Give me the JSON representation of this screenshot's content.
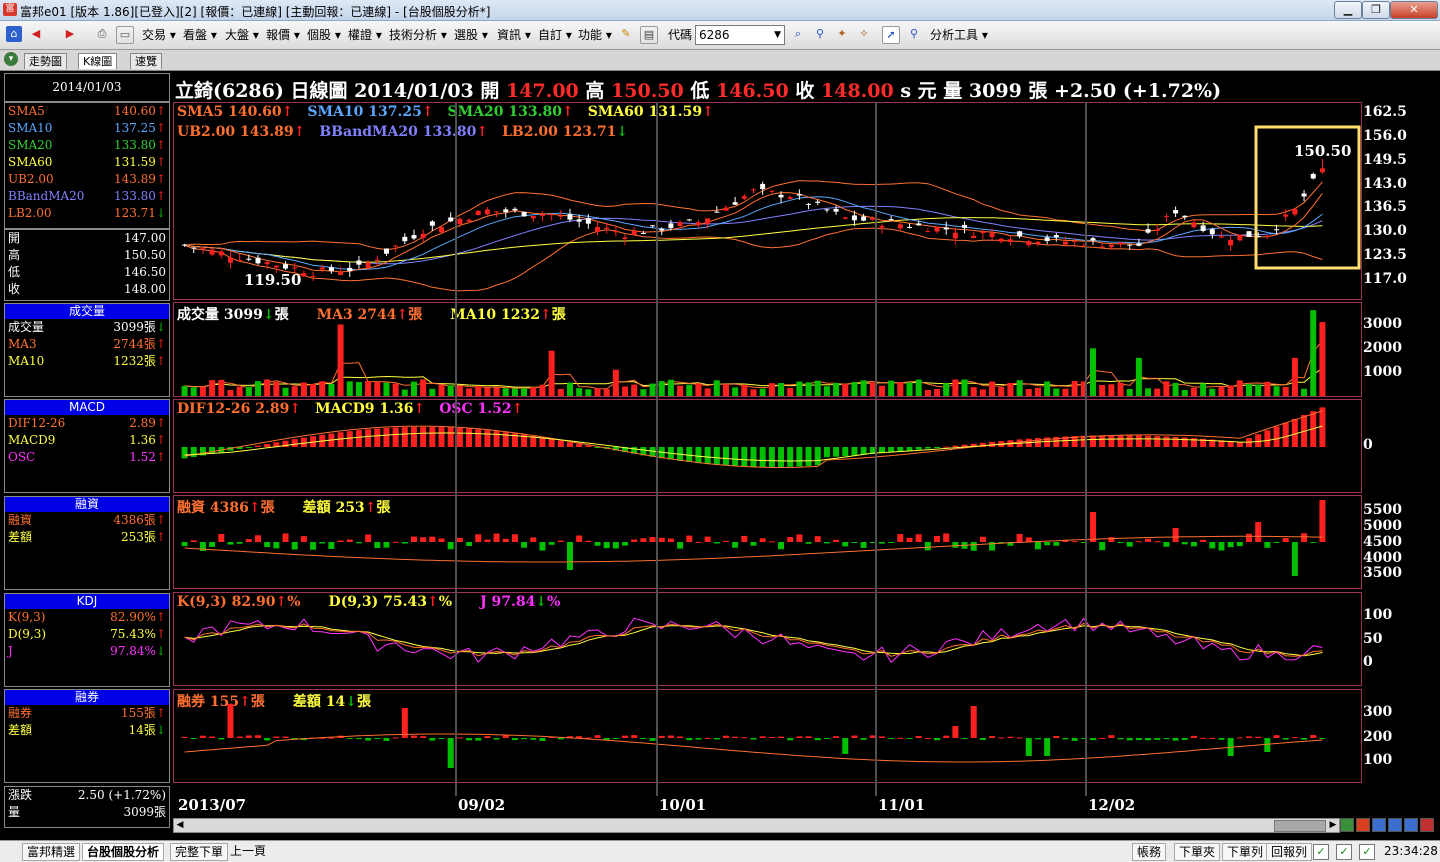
{
  "window": {
    "title": "富邦e01 [版本 1.86][已登入][2] [報價：已連線] [主動回報：已連線] - [台股個股分析*]",
    "controls": [
      "minimize",
      "restore",
      "close"
    ]
  },
  "toolbar": {
    "menus": [
      "交易",
      "看盤",
      "大盤",
      "報價",
      "個股",
      "權證",
      "技術分析",
      "選股",
      "資訊",
      "自訂",
      "功能"
    ],
    "code_label": "代碼",
    "code_value": "6286",
    "analysis_tools": "分析工具"
  },
  "subtabs": [
    "走勢圖",
    "K線圖",
    "速覽"
  ],
  "left": {
    "date": "2014/01/03",
    "ma_rows": [
      {
        "k": "SMA5",
        "v": "140.60",
        "color": "#ff7030",
        "arrow": "up"
      },
      {
        "k": "SMA10",
        "v": "137.25",
        "color": "#5aa7ff",
        "arrow": "up"
      },
      {
        "k": "SMA20",
        "v": "133.80",
        "color": "#30d030",
        "arrow": "up"
      },
      {
        "k": "SMA60",
        "v": "131.59",
        "color": "#ffff40",
        "arrow": "up"
      },
      {
        "k": "UB2.00",
        "v": "143.89",
        "color": "#ff7030",
        "arrow": "up"
      },
      {
        "k": "BBandMA20",
        "v": "133.80",
        "color": "#8080ff",
        "arrow": "up"
      },
      {
        "k": "LB2.00",
        "v": "123.71",
        "color": "#ff7030",
        "arrow": "down"
      }
    ],
    "ohlc_rows": [
      {
        "k": "開",
        "v": "147.00"
      },
      {
        "k": "高",
        "v": "150.50"
      },
      {
        "k": "低",
        "v": "146.50"
      },
      {
        "k": "收",
        "v": "148.00"
      }
    ],
    "vol": {
      "head": "成交量",
      "rows": [
        {
          "k": "成交量",
          "v": "3099張",
          "color": "#ffffff",
          "arrow": "down"
        },
        {
          "k": "MA3",
          "v": "2744張",
          "color": "#ff7030",
          "arrow": "up"
        },
        {
          "k": "MA10",
          "v": "1232張",
          "color": "#ffff40",
          "arrow": "up"
        }
      ]
    },
    "macd": {
      "head": "MACD",
      "rows": [
        {
          "k": "DIF12-26",
          "v": "2.89",
          "color": "#ff7030",
          "arrow": "up"
        },
        {
          "k": "MACD9",
          "v": "1.36",
          "color": "#ffff40",
          "arrow": "up"
        },
        {
          "k": "OSC",
          "v": "1.52",
          "color": "#ff30ff",
          "arrow": "up"
        }
      ]
    },
    "margin": {
      "head": "融資",
      "rows": [
        {
          "k": "融資",
          "v": "4386張",
          "color": "#ff7030",
          "arrow": "up"
        },
        {
          "k": "差額",
          "v": "253張",
          "color": "#ffff40",
          "arrow": "up"
        }
      ]
    },
    "kdj": {
      "head": "KDJ",
      "rows": [
        {
          "k": "K(9,3)",
          "v": "82.90%",
          "color": "#ff7030",
          "arrow": "up"
        },
        {
          "k": "D(9,3)",
          "v": "75.43%",
          "color": "#ffff40",
          "arrow": "up"
        },
        {
          "k": "J",
          "v": "97.84%",
          "color": "#ff30ff",
          "arrow": "down"
        }
      ]
    },
    "short": {
      "head": "融券",
      "rows": [
        {
          "k": "融券",
          "v": "155張",
          "color": "#ff7030",
          "arrow": "up"
        },
        {
          "k": "差額",
          "v": "14張",
          "color": "#ffff40",
          "arrow": "down"
        }
      ]
    },
    "bottom_rows": [
      {
        "k": "漲跌",
        "v": "2.50 (+1.72%)"
      },
      {
        "k": "量",
        "v": "3099張"
      }
    ]
  },
  "header": {
    "stock": "立錡(6286)",
    "period": "日線圖",
    "date": "2014/01/03",
    "open_label": "開",
    "open": "147.00",
    "high_label": "高",
    "high": "150.50",
    "low_label": "低",
    "low": "146.50",
    "close_label": "收",
    "close": "148.00",
    "unit": "s 元",
    "vol_label": "量",
    "vol": "3099 張",
    "change": "+2.50 (+1.72%)"
  },
  "price_legend": [
    [
      {
        "t": "SMA5 140.60",
        "c": "#ff7030",
        "a": "up"
      },
      {
        "t": "SMA10 137.25",
        "c": "#5aa7ff",
        "a": "up"
      },
      {
        "t": "SMA20 133.80",
        "c": "#30d030",
        "a": "up"
      },
      {
        "t": "SMA60 131.59",
        "c": "#ffff40",
        "a": "up"
      }
    ],
    [
      {
        "t": "UB2.00 143.89",
        "c": "#ff7030",
        "a": "up"
      },
      {
        "t": "BBandMA20 133.80",
        "c": "#8080ff",
        "a": "up"
      },
      {
        "t": "LB2.00 123.71",
        "c": "#ff7030",
        "a": "down"
      }
    ]
  ],
  "price_annotations": {
    "high_label": "150.50",
    "low_label": "119.50"
  },
  "vol_legend": [
    {
      "t": "成交量 3099",
      "c": "#ffffff",
      "a": "down",
      "s": "張"
    },
    {
      "t": "MA3 2744",
      "c": "#ff7030",
      "a": "up",
      "s": "張"
    },
    {
      "t": "MA10 1232",
      "c": "#ffff40",
      "a": "up",
      "s": "張"
    }
  ],
  "macd_legend": [
    {
      "t": "DIF12-26 2.89",
      "c": "#ff7030",
      "a": "up",
      "s": ""
    },
    {
      "t": "MACD9 1.36",
      "c": "#ffff40",
      "a": "up",
      "s": ""
    },
    {
      "t": "OSC 1.52",
      "c": "#ff30ff",
      "a": "up",
      "s": ""
    }
  ],
  "margin_legend": [
    {
      "t": "融資 4386",
      "c": "#ff7030",
      "a": "up",
      "s": "張"
    },
    {
      "t": "差額 253",
      "c": "#ffff40",
      "a": "up",
      "s": "張"
    }
  ],
  "kdj_legend": [
    {
      "t": "K(9,3) 82.90",
      "c": "#ff7030",
      "a": "up",
      "s": "%"
    },
    {
      "t": "D(9,3) 75.43",
      "c": "#ffff40",
      "a": "up",
      "s": "%"
    },
    {
      "t": "J 97.84",
      "c": "#ff30ff",
      "a": "down",
      "s": "%"
    }
  ],
  "short_legend": [
    {
      "t": "融券 155",
      "c": "#ff7030",
      "a": "up",
      "s": "張"
    },
    {
      "t": "差額 14",
      "c": "#ffff40",
      "a": "down",
      "s": "張"
    }
  ],
  "axes": {
    "price": [
      "162.5",
      "156.0",
      "149.5",
      "143.0",
      "136.5",
      "130.0",
      "123.5",
      "117.0"
    ],
    "vol": [
      "3000",
      "2000",
      "1000"
    ],
    "macd": [
      "0"
    ],
    "margin": [
      "5500",
      "5000",
      "4500",
      "4000",
      "3500"
    ],
    "kdj": [
      "100",
      "50",
      "0"
    ],
    "short": [
      "300",
      "200",
      "100"
    ]
  },
  "x_labels": [
    "2013/07",
    "09/02",
    "10/01",
    "11/01",
    "12/02"
  ],
  "statusbar": {
    "tabs": [
      "富邦精選",
      "台股個股分析",
      "完整下單",
      "上一頁"
    ],
    "buttons": [
      "帳務",
      "下單夾",
      "下單列",
      "回報列"
    ],
    "time": "23:34:28"
  },
  "colors": {
    "up": "#ff2020",
    "down": "#00c000",
    "highlight": "#ffe070"
  }
}
